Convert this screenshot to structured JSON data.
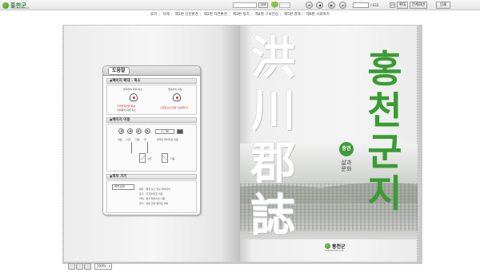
{
  "header": {
    "logo_text": "홍천군",
    "logo_sub": "HONGCHEON-GUN",
    "search_button": "검색",
    "page_total": "/ 632",
    "zoom_button": "확대",
    "fullscreen_button": "전체화면",
    "print_button": "인쇄"
  },
  "menu": {
    "items": [
      "표지",
      "차례",
      "제1편 인문환경",
      "제2편 자연환경",
      "제3편 정치",
      "제4편 구비전승",
      "제5편 경제",
      "제6편 사회복지"
    ]
  },
  "help": {
    "title": "도움말",
    "section1": "페이지 확대 · 축소",
    "s1_left": "클릭하여 확대 축소",
    "s1_right": "클릭하여 이동",
    "s1_note_left": "더블클릭하면 확대",
    "s1_note_left2": "자유롭게 화면 축소",
    "s1_note_right": "오른쪽으로 이동 다음페이지",
    "section2": "페이지 이동",
    "s2_labels": [
      "처음",
      "이전",
      "다음",
      "끝"
    ],
    "s2_page": "1 / 96",
    "s2_note": "입력한 페이지로 이동",
    "s2_label_prev": "이전",
    "s2_label_next": "다음",
    "section3": "목차 가기",
    "s3_select": "목차검색",
    "s3_notes": [
      "목차 : 현재 보고 있는 페이지의",
      "표지 : 첫 페이지로 이동",
      "차례 : 목차 페이지로 이동",
      "찾기 : 본문 검색 결과로 이동"
    ]
  },
  "cover": {
    "hanja_title": [
      "洪",
      "川",
      "郡",
      "誌"
    ],
    "title": [
      "홍",
      "천",
      "군",
      "지"
    ],
    "volume": "중권",
    "subtitle": "삶과 문화",
    "publisher": "홍천군",
    "publisher_sub": "HONGCHEON-GUN"
  },
  "footer": {
    "zoom_value": "100%"
  },
  "colors": {
    "brand_green": "#3a9b35",
    "accent_red": "#cc3333"
  }
}
